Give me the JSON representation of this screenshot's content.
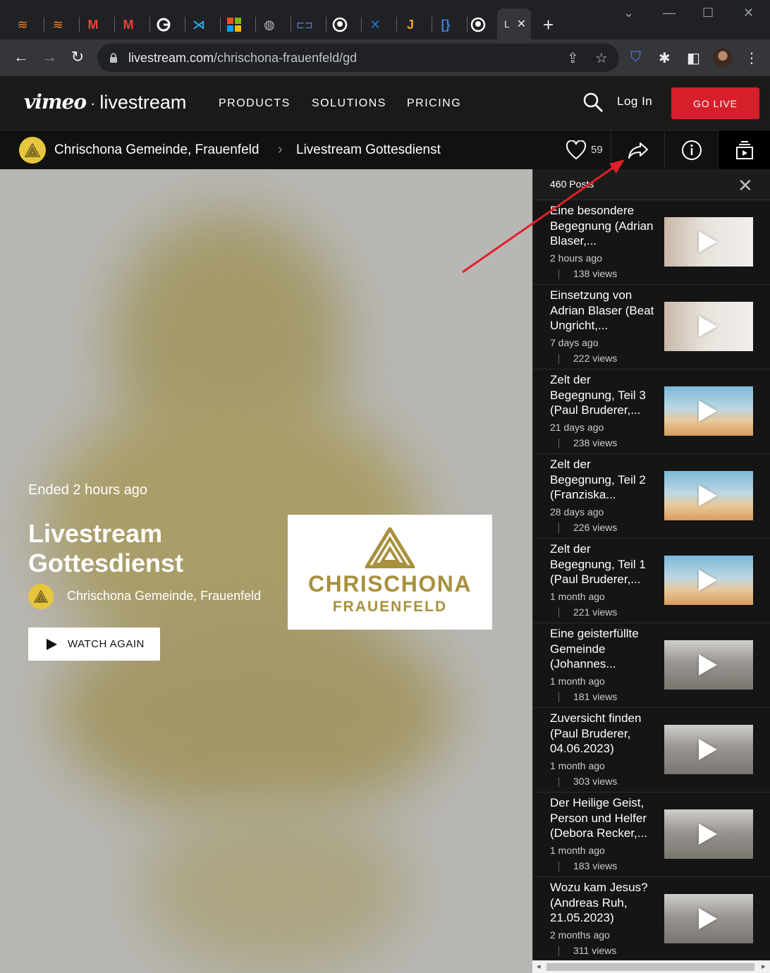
{
  "browser": {
    "active_tab_title": "L",
    "url_domain": "livestream.com",
    "url_path": "/chrischona-frauenfeld/gd"
  },
  "header": {
    "brand_vimeo": "vimeo",
    "brand_dot": "·",
    "brand_livestream": "livestream",
    "nav": [
      "PRODUCTS",
      "SOLUTIONS",
      "PRICING"
    ],
    "login": "Log In",
    "golive": "GO LIVE"
  },
  "channel": {
    "owner": "Chrischona Gemeinde, Frauenfeld",
    "event": "Livestream Gottesdienst",
    "likes": "59"
  },
  "player": {
    "ended": "Ended 2 hours ago",
    "title": "Livestream Gottesdienst",
    "owner": "Chrischona Gemeinde, Frauenfeld",
    "watch_again": "WATCH AGAIN",
    "logo_line1": "CHRISCHONA",
    "logo_line2": "FRAUENFELD"
  },
  "sidebar": {
    "count": "460 Posts",
    "posts": [
      {
        "title": "Eine besondere Begegnung (Adrian Blaser,...",
        "time": "2 hours ago",
        "views": "138 views",
        "thumb": "summer"
      },
      {
        "title": "Einsetzung von Adrian Blaser (Beat Ungricht,...",
        "time": "7 days ago",
        "views": "222 views",
        "thumb": "summer"
      },
      {
        "title": "Zelt der Begegnung, Teil 3 (Paul Bruderer,...",
        "time": "21 days ago",
        "views": "238 views",
        "thumb": "zelt"
      },
      {
        "title": "Zelt der Begegnung, Teil 2 (Franziska...",
        "time": "28 days ago",
        "views": "226 views",
        "thumb": "zelt"
      },
      {
        "title": "Zelt der Begegnung, Teil 1 (Paul Bruderer,...",
        "time": "1 month ago",
        "views": "221 views",
        "thumb": "zelt"
      },
      {
        "title": "Eine geisterfüllte Gemeinde (Johannes...",
        "time": "1 month ago",
        "views": "181 views",
        "thumb": "insp"
      },
      {
        "title": "Zuversicht finden (Paul Bruderer, 04.06.2023)",
        "time": "1 month ago",
        "views": "303 views",
        "thumb": "insp"
      },
      {
        "title": "Der Heilige Geist, Person und Helfer (Debora Recker,...",
        "time": "1 month ago",
        "views": "183 views",
        "thumb": "insp"
      },
      {
        "title": "Wozu kam Jesus? (Andreas Ruh, 21.05.2023)",
        "time": "2 months ago",
        "views": "311 views",
        "thumb": "insp"
      }
    ]
  },
  "colors": {
    "accent_red": "#d61f2a",
    "brand_gold": "#a8903e",
    "avatar_yellow": "#e6c63c"
  }
}
